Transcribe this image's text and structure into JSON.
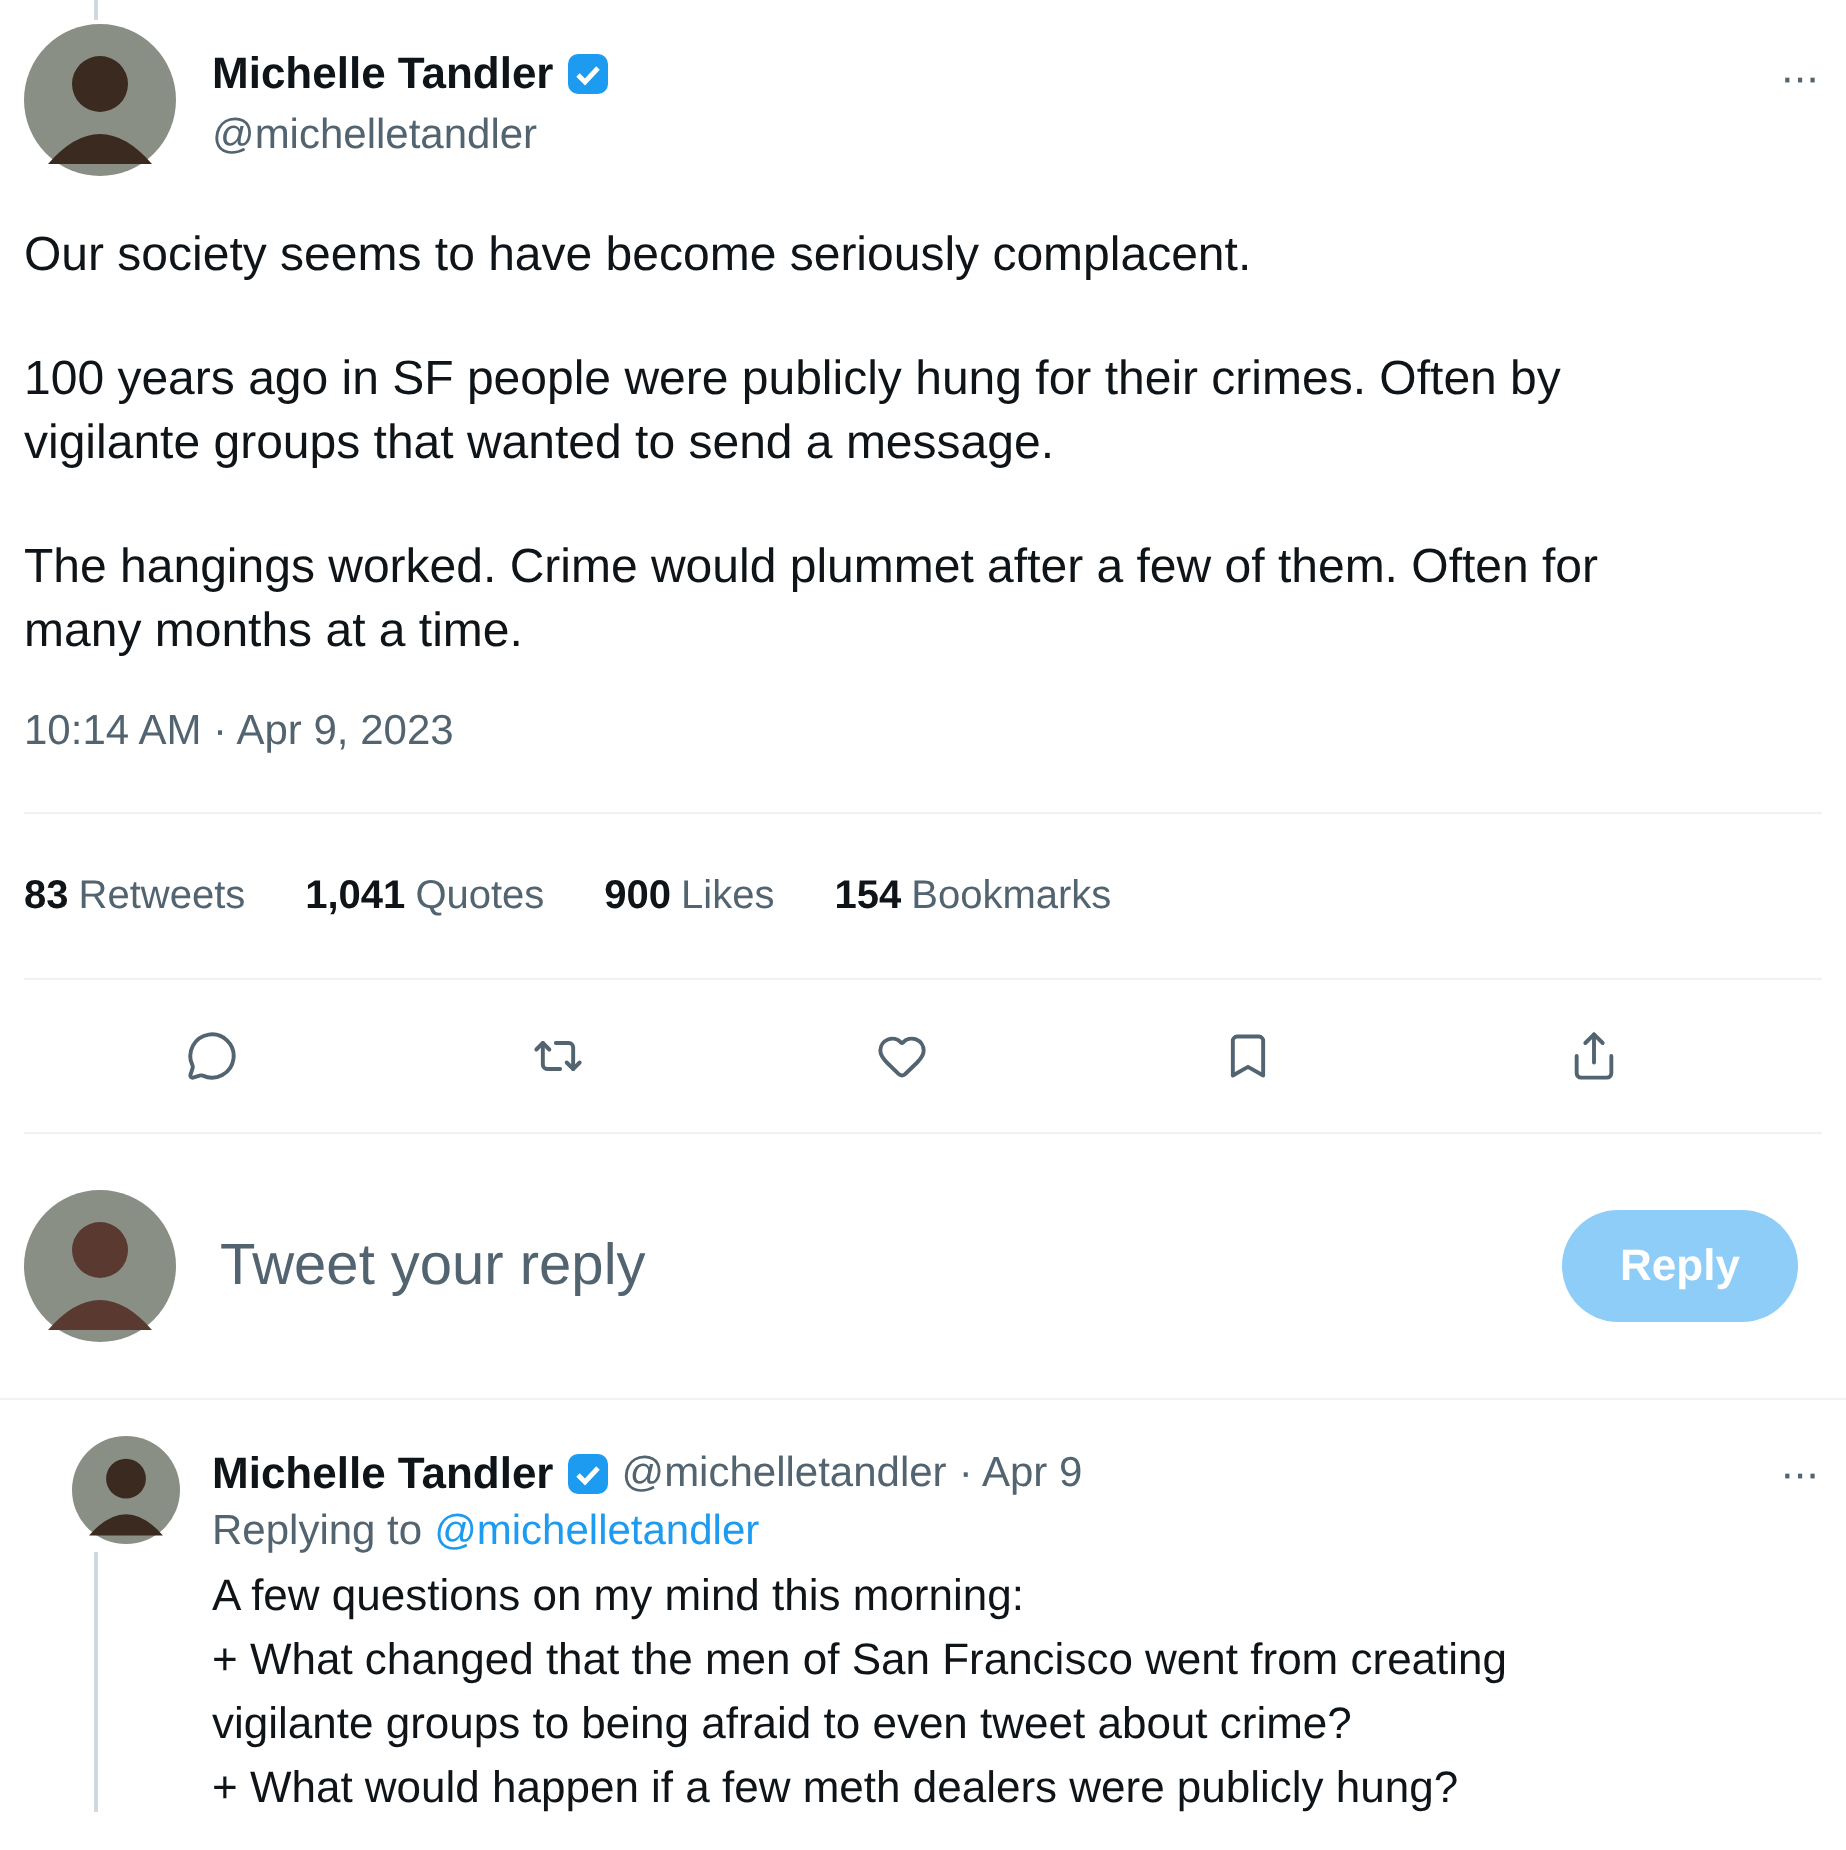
{
  "tweet": {
    "author": {
      "name": "Michelle Tandler",
      "handle": "@michelletandler",
      "verified": true
    },
    "more": "···",
    "paragraphs": [
      "Our society seems to have become seriously complacent.",
      "100 years ago in SF people were publicly hung for their crimes. Often by vigilante groups that wanted to send a message.",
      "The hangings worked. Crime would plummet after a few of them. Often for many months at a time."
    ],
    "timestamp": "10:14 AM · Apr 9, 2023",
    "stats": [
      {
        "count": "83",
        "label": "Retweets"
      },
      {
        "count": "1,041",
        "label": "Quotes"
      },
      {
        "count": "900",
        "label": "Likes"
      },
      {
        "count": "154",
        "label": "Bookmarks"
      }
    ]
  },
  "reply_box": {
    "placeholder": "Tweet your reply",
    "button": "Reply",
    "disabled": true
  },
  "reply": {
    "author": {
      "name": "Michelle Tandler",
      "handle": "@michelletandler",
      "verified": true
    },
    "date": "· Apr 9",
    "more": "···",
    "replying_to_label": "Replying to",
    "replying_to": "@michelletandler",
    "lines": [
      "A few questions on my mind this morning:",
      "+ What changed that the men of San Francisco went from creating vigilante groups to being afraid to even tweet about crime?",
      "+ What would happen if a few meth dealers were publicly hung?"
    ]
  }
}
